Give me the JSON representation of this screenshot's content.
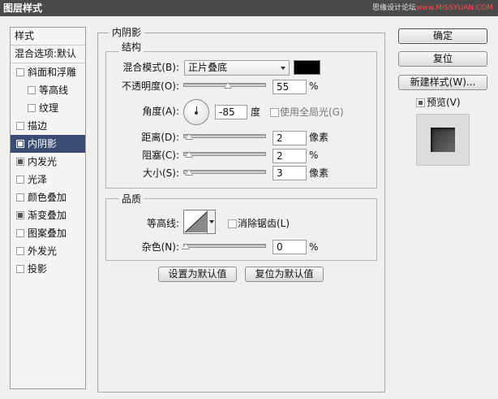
{
  "window": {
    "title": "图层样式"
  },
  "watermark": {
    "prefix": "思缘设计论坛",
    "site": "www.MISSYUAN.COM"
  },
  "styles": {
    "header": "样式",
    "blend_default": "混合选项:默认",
    "items": [
      {
        "label": "斜面和浮雕",
        "checked": false,
        "indent": false
      },
      {
        "label": "等高线",
        "checked": false,
        "indent": true
      },
      {
        "label": "纹理",
        "checked": false,
        "indent": true
      },
      {
        "label": "描边",
        "checked": false,
        "indent": false
      },
      {
        "label": "内阴影",
        "checked": true,
        "indent": false,
        "selected": true
      },
      {
        "label": "内发光",
        "checked": true,
        "indent": false
      },
      {
        "label": "光泽",
        "checked": false,
        "indent": false
      },
      {
        "label": "颜色叠加",
        "checked": false,
        "indent": false
      },
      {
        "label": "渐变叠加",
        "checked": true,
        "indent": false
      },
      {
        "label": "图案叠加",
        "checked": false,
        "indent": false
      },
      {
        "label": "外发光",
        "checked": false,
        "indent": false
      },
      {
        "label": "投影",
        "checked": false,
        "indent": false
      }
    ]
  },
  "inner_shadow": {
    "title": "内阴影",
    "structure": {
      "title": "结构",
      "blend_mode_label": "混合模式(B):",
      "blend_mode_value": "正片叠底",
      "color": "#000000",
      "opacity_label": "不透明度(O):",
      "opacity_value": "55",
      "opacity": 55,
      "angle_label": "角度(A):",
      "angle_value": "-85",
      "angle_unit": "度",
      "global_light_label": "使用全局光(G)",
      "global_light": false,
      "distance_label": "距离(D):",
      "distance_value": "2",
      "distance_unit": "像素",
      "choke_label": "阻塞(C):",
      "choke_value": "2",
      "size_label": "大小(S):",
      "size_value": "3",
      "size_unit": "像素",
      "percent": "%"
    },
    "quality": {
      "title": "品质",
      "contour_label": "等高线:",
      "antialias_label": "消除锯齿(L)",
      "antialias": false,
      "noise_label": "杂色(N):",
      "noise_value": "0",
      "noise": 0,
      "percent": "%"
    },
    "set_default": "设置为默认值",
    "reset_default": "复位为默认值"
  },
  "buttons": {
    "ok": "确定",
    "reset": "复位",
    "new_style": "新建样式(W)...",
    "preview_label": "预览(V)",
    "preview_checked": true
  },
  "colors": {
    "selected_bg": "#3a4c73",
    "titlebar": "#4a4a4a"
  }
}
